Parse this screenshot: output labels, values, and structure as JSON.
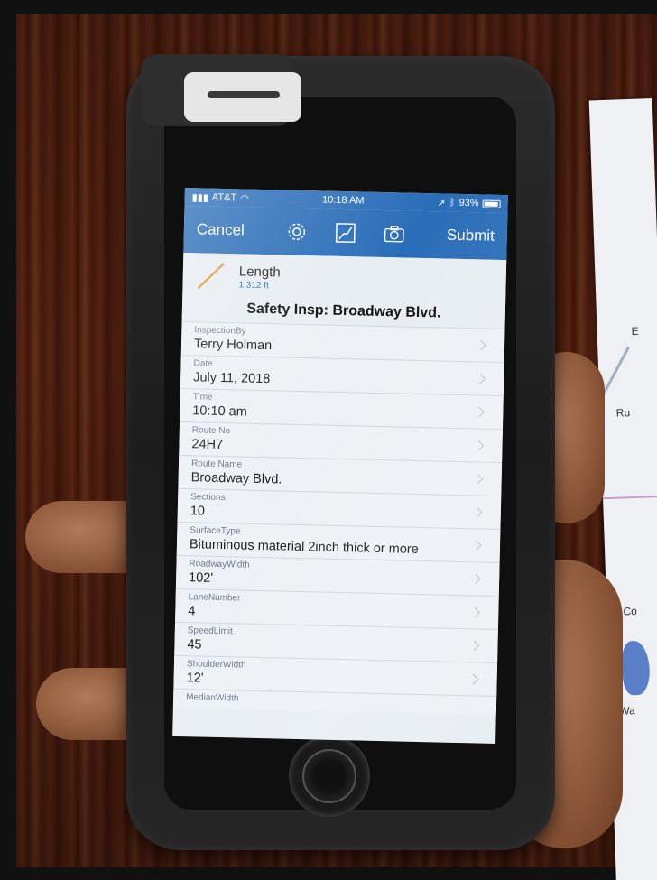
{
  "status_bar": {
    "carrier": "AT&T",
    "time": "10:18 AM",
    "battery": "93%"
  },
  "nav": {
    "cancel_label": "Cancel",
    "submit_label": "Submit",
    "icons": [
      "gear-icon",
      "edit-geometry-icon",
      "camera-icon"
    ]
  },
  "feature": {
    "title": "Length",
    "value": "1,312 ft",
    "form_title": "Safety Insp: Broadway Blvd."
  },
  "fields": [
    {
      "label": "InspectionBy",
      "value": "Terry Holman"
    },
    {
      "label": "Date",
      "value": "July 11, 2018"
    },
    {
      "label": "Time",
      "value": "10:10 am"
    },
    {
      "label": "Route No",
      "value": "24H7"
    },
    {
      "label": "Route Name",
      "value": "Broadway Blvd."
    },
    {
      "label": "Sections",
      "value": "10"
    },
    {
      "label": "SurfaceType",
      "value": "Bituminous material 2inch thick or more"
    },
    {
      "label": "RoadwayWidth",
      "value": "102'"
    },
    {
      "label": "LaneNumber",
      "value": "4"
    },
    {
      "label": "SpeedLimit",
      "value": "45"
    },
    {
      "label": "ShoulderWidth",
      "value": "12'"
    },
    {
      "label": "MedianWidth",
      "value": ""
    }
  ],
  "map_labels": [
    "E",
    "Ru",
    "Co",
    "Wa"
  ],
  "colors": {
    "nav_blue": "#2a6db8",
    "screen_bg": "#e9eef3",
    "length_line": "#e0a040"
  }
}
